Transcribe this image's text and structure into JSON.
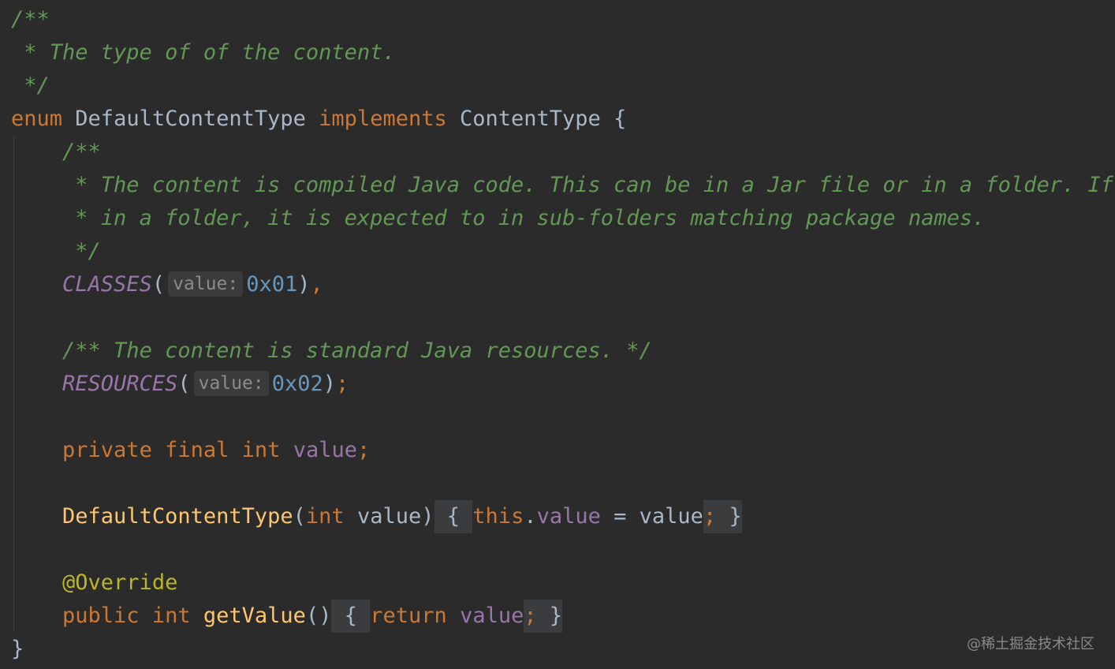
{
  "editor": {
    "language": "Java",
    "colors": {
      "background": "#2b2b2b",
      "keyword": "#cc7832",
      "comment": "#629755",
      "field": "#9876aa",
      "number": "#6897bb",
      "annotation": "#bbb529",
      "method": "#ffc66d",
      "text": "#a9b7c6"
    },
    "code": {
      "c1": "/**",
      "c2": " * The type of of the content.",
      "c3": " */",
      "enum_kw": "enum",
      "class_name": "DefaultContentType",
      "implements_kw": "implements",
      "iface_name": "ContentType",
      "open_brace": "{",
      "d1": "/**",
      "d2": " * The content is compiled Java code. This can be in a Jar file or in a folder. If",
      "d3": " * in a folder, it is expected to in sub-folders matching package names.",
      "d4": " */",
      "classes_const": "CLASSES",
      "hint_value": "value:",
      "classes_num": "0x01",
      "comma": ",",
      "r_comment": "/** The content is standard Java resources. */",
      "resources_const": "RESOURCES",
      "resources_num": "0x02",
      "semi": ";",
      "private_kw": "private",
      "final_kw": "final",
      "int_kw": "int",
      "value_field": "value",
      "ctor_name": "DefaultContentType",
      "param_value": "value",
      "this_kw": "this",
      "assign": " = ",
      "override_ann": "@Override",
      "public_kw": "public",
      "getvalue_name": "getValue",
      "return_kw": "return",
      "close_brace": "}"
    }
  },
  "watermark": "@稀土掘金技术社区"
}
